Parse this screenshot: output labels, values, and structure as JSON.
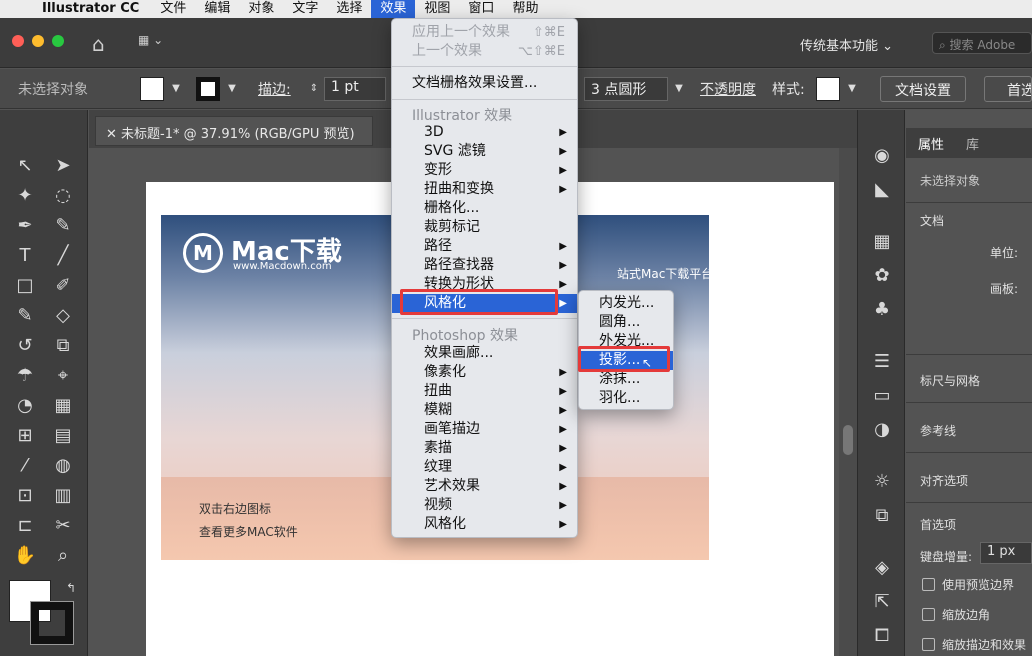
{
  "menubar": {
    "app": "Illustrator CC",
    "items": [
      "文件",
      "编辑",
      "对象",
      "文字",
      "选择",
      "效果",
      "视图",
      "窗口",
      "帮助"
    ],
    "active": "效果"
  },
  "titlebar": {
    "workspace": "传统基本功能",
    "search_placeholder": "搜索 Adobe"
  },
  "controlbar": {
    "selection": "未选择对象",
    "stroke_label": "描边:",
    "stroke_value": "1 pt",
    "brush": "3 点圆形",
    "opacity_label": "不透明度",
    "style_label": "样式:",
    "doc_settings": "文档设置",
    "prefs": "首选"
  },
  "document": {
    "tab_title": "未标题-1* @ 37.91% (RGB/GPU 预览)",
    "logo_letter": "M",
    "logo_text": "Mac下载",
    "logo_url": "www.Macdown.com",
    "slogan": "站式Mac下载平台",
    "bottom_line1": "双击右边图标",
    "bottom_line2": "查看更多MAC软件"
  },
  "effect_menu": {
    "apply_last": "应用上一个效果",
    "apply_last_sc": "⇧⌘E",
    "last": "上一个效果",
    "last_sc": "⌥⇧⌘E",
    "doc_raster": "文档栅格效果设置...",
    "header_ai": "Illustrator 效果",
    "ai_items": [
      "3D",
      "SVG 滤镜",
      "变形",
      "扭曲和变换",
      "栅格化...",
      "裁剪标记",
      "路径",
      "路径查找器",
      "转换为形状",
      "风格化"
    ],
    "header_ps": "Photoshop 效果",
    "ps_items": [
      "效果画廊...",
      "像素化",
      "扭曲",
      "模糊",
      "画笔描边",
      "素描",
      "纹理",
      "艺术效果",
      "视频",
      "风格化"
    ]
  },
  "stylize_submenu": {
    "items": [
      "内发光...",
      "圆角...",
      "外发光...",
      "投影...",
      "涂抹...",
      "羽化..."
    ],
    "selected": "投影..."
  },
  "properties": {
    "tab1": "属性",
    "tab2": "库",
    "no_selection": "未选择对象",
    "doc": "文档",
    "units": "单位:",
    "artboard": "画板:",
    "rulers": "标尺与网格",
    "guides": "参考线",
    "align": "对齐选项",
    "prefs": "首选项",
    "key_increment": "键盘增量:",
    "key_value": "1 px",
    "chk1": "使用预览边界",
    "chk2": "缩放边角",
    "chk3": "缩放描边和效果"
  },
  "colors": {
    "accent": "#2a64d6",
    "highlight_box": "#e43a3a"
  }
}
